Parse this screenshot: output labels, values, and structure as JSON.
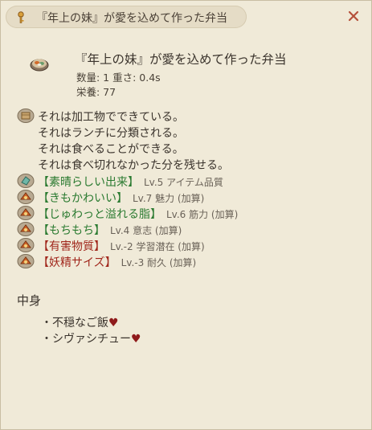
{
  "window": {
    "title": "『年上の妹』が愛を込めて作った弁当",
    "close_glyph": "✕"
  },
  "item": {
    "name": "『年上の妹』が愛を込めて作った弁当",
    "quantity_line": "数量: 1  重さ: 0.4s",
    "nutrition_line": "栄養: 77"
  },
  "description": [
    "それは加工物でできている。",
    "それはランチに分類される。",
    "それは食べることができる。",
    "それは食べ切れなかった分を残せる。"
  ],
  "traits": [
    {
      "name": "【素晴らしい出来】",
      "detail": "Lv.5 アイテム品質",
      "kind": "good",
      "icon": "gem-icon"
    },
    {
      "name": "【きもかわいい】",
      "detail": "Lv.7 魅力 (加算)",
      "kind": "good",
      "icon": "food-icon"
    },
    {
      "name": "【じゅわっと溢れる脂】",
      "detail": "Lv.6 筋力 (加算)",
      "kind": "good",
      "icon": "food-icon"
    },
    {
      "name": "【もちもち】",
      "detail": "Lv.4 意志 (加算)",
      "kind": "good",
      "icon": "food-icon"
    },
    {
      "name": "【有害物質】",
      "detail": "Lv.-2 学習潜在 (加算)",
      "kind": "bad",
      "icon": "food-icon"
    },
    {
      "name": "【妖精サイズ】",
      "detail": "Lv.-3 耐久 (加算)",
      "kind": "bad",
      "icon": "food-icon"
    }
  ],
  "contents": {
    "heading": "中身",
    "items": [
      {
        "bullet": "・",
        "text": "不穏なご飯",
        "heart": "♥"
      },
      {
        "bullet": "・",
        "text": "シヴァシチュー",
        "heart": "♥"
      }
    ]
  },
  "colors": {
    "good": "#2a7a30",
    "bad": "#a1281d",
    "heart": "#8f1b1b",
    "background": "#f0ead8"
  }
}
